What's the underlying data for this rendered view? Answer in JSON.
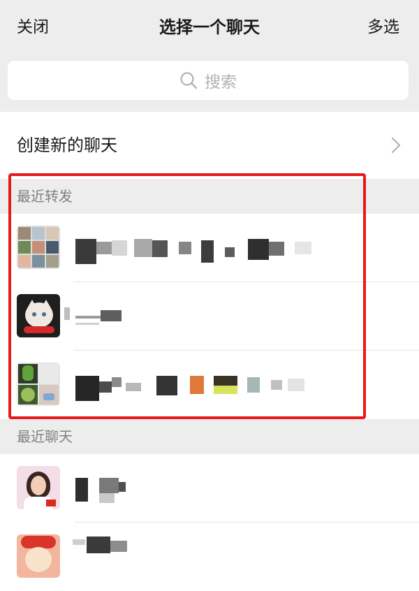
{
  "nav": {
    "close_label": "关闭",
    "title": "选择一个聊天",
    "multi_select_label": "多选"
  },
  "search": {
    "placeholder": "搜索",
    "icon": "search-icon"
  },
  "new_chat": {
    "label": "创建新的聊天",
    "icon": "chevron-right-icon"
  },
  "recent_forward": {
    "header": "最近转发",
    "items": [
      {
        "avatar": "group-grid-avatar"
      },
      {
        "avatar": "cat-avatar"
      },
      {
        "avatar": "frog-group-avatar"
      }
    ]
  },
  "recent_chats": {
    "header": "最近聊天",
    "items": [
      {
        "avatar": "person-avatar"
      },
      {
        "avatar": "cartoon-avatar"
      }
    ]
  },
  "colors": {
    "background": "#ededed",
    "highlight": "#e8191d",
    "row": "#ffffff"
  }
}
